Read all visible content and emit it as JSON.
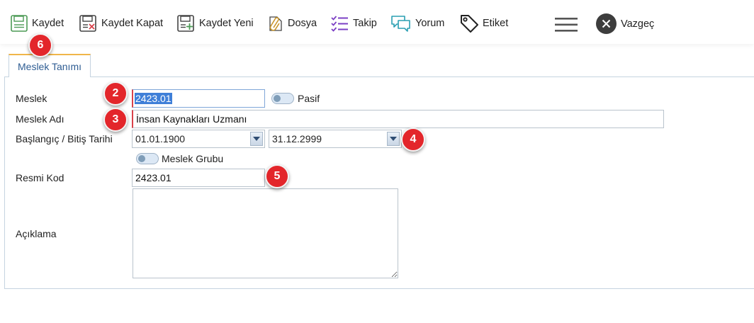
{
  "toolbar": {
    "save": "Kaydet",
    "save_close": "Kaydet Kapat",
    "save_new": "Kaydet Yeni",
    "file": "Dosya",
    "follow": "Takip",
    "comment": "Yorum",
    "tag": "Etiket",
    "cancel": "Vazgeç"
  },
  "tabs": [
    {
      "label": "Meslek Tanımı",
      "active": true
    }
  ],
  "form": {
    "code_label": "Meslek",
    "code_value": "2423.01",
    "passive_label": "Pasif",
    "name_label": "Meslek Adı",
    "name_value": "İnsan Kaynakları Uzmanı",
    "dates_label": "Başlangıç / Bitiş Tarihi",
    "start_date": "01.01.1900",
    "end_date": "31.12.2999",
    "group_label": "Meslek Grubu",
    "official_code_label": "Resmi Kod",
    "official_code_value": "2423.01",
    "description_label": "Açıklama",
    "description_value": ""
  },
  "annotations": [
    "2",
    "3",
    "4",
    "5",
    "6"
  ],
  "colors": {
    "accent": "#3f7fd8",
    "badge": "#e3262b",
    "tab_top": "#f0b64a",
    "required": "#d9414a"
  }
}
